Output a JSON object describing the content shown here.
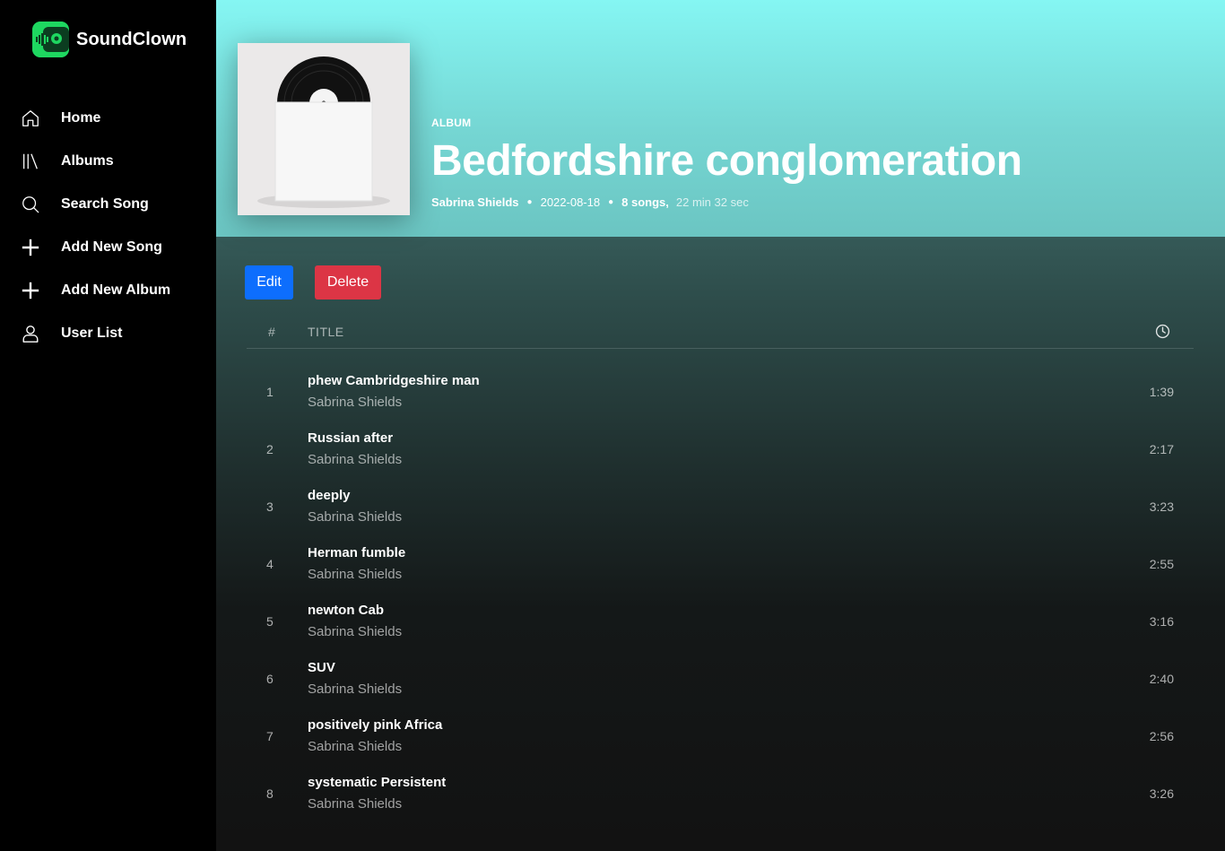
{
  "app": {
    "name": "SoundClown",
    "accent": "#1ed760"
  },
  "sidebar": {
    "items": [
      {
        "label": "Home",
        "icon": "home-icon"
      },
      {
        "label": "Albums",
        "icon": "library-icon"
      },
      {
        "label": "Search Song",
        "icon": "search-icon"
      },
      {
        "label": "Add New Song",
        "icon": "plus-icon"
      },
      {
        "label": "Add New Album",
        "icon": "plus-icon"
      },
      {
        "label": "User List",
        "icon": "user-icon"
      }
    ]
  },
  "album": {
    "type": "ALBUM",
    "title": "Bedfordshire conglomeration",
    "artist": "Sabrina Shields",
    "date": "2022-08-18",
    "song_count": "8 songs,",
    "duration": "22 min 32 sec",
    "header_color": "#85f6f3"
  },
  "actions": {
    "edit_label": "Edit",
    "delete_label": "Delete",
    "edit_color": "#0d6efd",
    "delete_color": "#dc3545"
  },
  "table": {
    "num_header": "#",
    "title_header": "TITLE",
    "duration_icon": "clock-icon"
  },
  "tracks": [
    {
      "num": "1",
      "title": "phew Cambridgeshire man",
      "artist": "Sabrina Shields",
      "duration": "1:39"
    },
    {
      "num": "2",
      "title": "Russian after",
      "artist": "Sabrina Shields",
      "duration": "2:17"
    },
    {
      "num": "3",
      "title": "deeply",
      "artist": "Sabrina Shields",
      "duration": "3:23"
    },
    {
      "num": "4",
      "title": "Herman fumble",
      "artist": "Sabrina Shields",
      "duration": "2:55"
    },
    {
      "num": "5",
      "title": "newton Cab",
      "artist": "Sabrina Shields",
      "duration": "3:16"
    },
    {
      "num": "6",
      "title": "SUV",
      "artist": "Sabrina Shields",
      "duration": "2:40"
    },
    {
      "num": "7",
      "title": "positively pink Africa",
      "artist": "Sabrina Shields",
      "duration": "2:56"
    },
    {
      "num": "8",
      "title": "systematic Persistent",
      "artist": "Sabrina Shields",
      "duration": "3:26"
    }
  ]
}
